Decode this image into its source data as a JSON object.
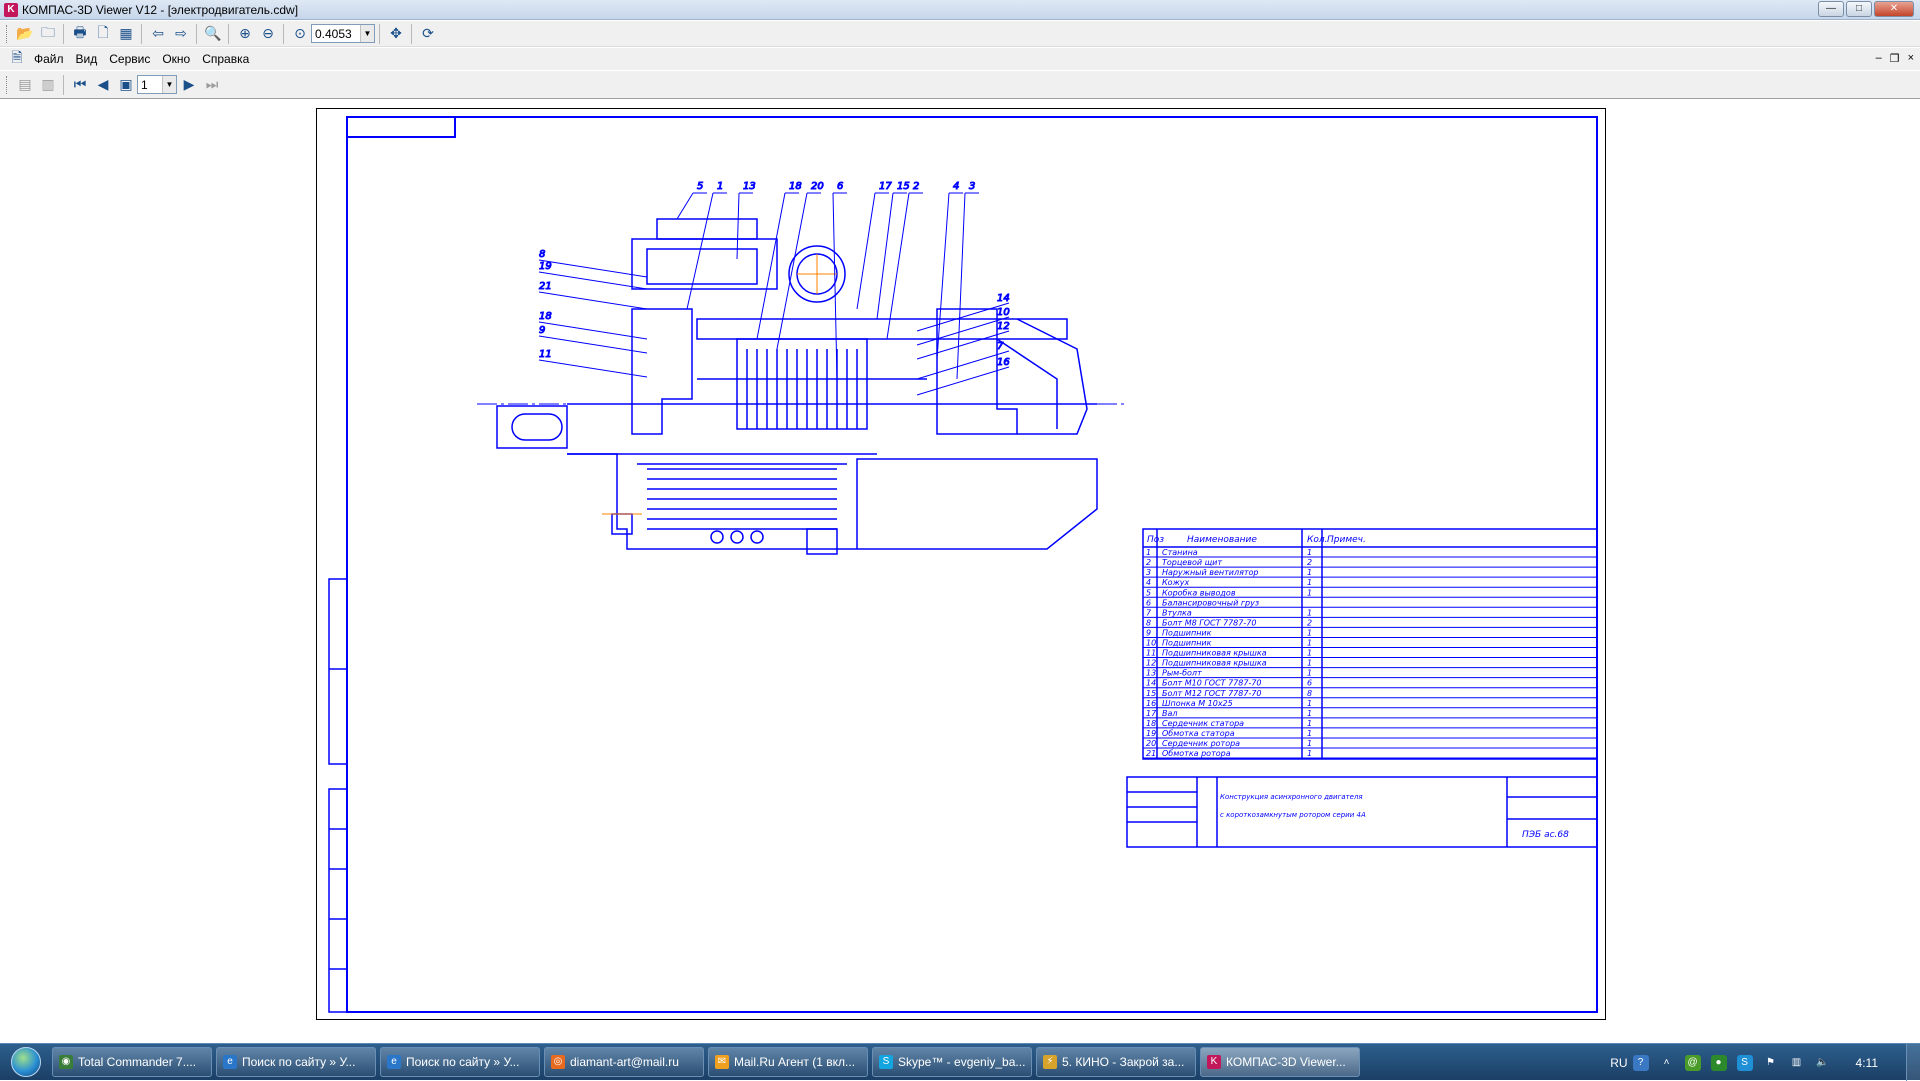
{
  "window": {
    "title": "КОМПАС-3D Viewer V12 - [электродвигатель.cdw]",
    "minimize_glyph": "—",
    "maximize_glyph": "□",
    "close_glyph": "✕"
  },
  "toolbar": {
    "zoom_value": "0.4053"
  },
  "menu": {
    "items": [
      "Файл",
      "Вид",
      "Сервис",
      "Окно",
      "Справка"
    ],
    "mdi_minimize": "–",
    "mdi_restore": "❐",
    "mdi_close": "×"
  },
  "toolbar2": {
    "page_value": "1"
  },
  "drawing": {
    "leader_labels_top": [
      "5",
      "1",
      "13",
      "18",
      "20",
      "6",
      "17",
      "15",
      "2",
      "4",
      "3"
    ],
    "leader_labels_left": [
      "8",
      "19",
      "21",
      "18",
      "9",
      "11"
    ],
    "leader_labels_right": [
      "14",
      "10",
      "12",
      "7",
      "16"
    ],
    "bom_headers": [
      "Поз",
      "Наименование",
      "Кол.",
      "Примеч."
    ],
    "bom": [
      [
        "1",
        "Станина",
        "1"
      ],
      [
        "2",
        "Торцевой щит",
        "2"
      ],
      [
        "3",
        "Наружный вентилятор",
        "1"
      ],
      [
        "4",
        "Кожух",
        "1"
      ],
      [
        "5",
        "Коробка выводов",
        "1"
      ],
      [
        "6",
        "Балансировочный груз",
        ""
      ],
      [
        "7",
        "Втулка",
        "1"
      ],
      [
        "8",
        "Болт М8 ГОСТ 7787-70",
        "2"
      ],
      [
        "9",
        "Подшипник",
        "1"
      ],
      [
        "10",
        "Подшипник",
        "1"
      ],
      [
        "11",
        "Подшипниковая крышка",
        "1"
      ],
      [
        "12",
        "Подшипниковая крышка",
        "1"
      ],
      [
        "13",
        "Рым-болт",
        "1"
      ],
      [
        "14",
        "Болт М10 ГОСТ 7787-70",
        "6"
      ],
      [
        "15",
        "Болт М12 ГОСТ 7787-70",
        "8"
      ],
      [
        "16",
        "Шпонка М 10х25",
        "1"
      ],
      [
        "17",
        "Вал",
        "1"
      ],
      [
        "18",
        "Сердечник статора",
        "1"
      ],
      [
        "19",
        "Обмотка статора",
        "1"
      ],
      [
        "20",
        "Сердечник ротора",
        "1"
      ],
      [
        "21",
        "Обмотка ротора",
        "1"
      ]
    ],
    "title_block_line1": "Конструкция асинхронного двигателя",
    "title_block_line2": "с короткозамкнутым ротором серии 4А",
    "designation": "ПЭБ ас.68"
  },
  "taskbar": {
    "tasks": [
      {
        "label": "Total Commander 7....",
        "icon": "tc-icon"
      },
      {
        "label": "Поиск по сайту » У...",
        "icon": "ie-icon"
      },
      {
        "label": "Поиск по сайту » У...",
        "icon": "ie-icon"
      },
      {
        "label": "diamant-art@mail.ru",
        "icon": "firefox-icon"
      },
      {
        "label": "Mail.Ru Агент (1 вкл...",
        "icon": "mailru-agent-icon"
      },
      {
        "label": "Skype™ - evgeniy_ba...",
        "icon": "skype-icon"
      },
      {
        "label": "5. КИНО - Закрой за...",
        "icon": "winamp-icon"
      },
      {
        "label": "КОМПАС-3D Viewer...",
        "icon": "kompas-icon"
      }
    ],
    "language": "RU",
    "clock": "4:11"
  },
  "colors": {
    "drawing_line": "#0000ff",
    "taskbar": "#1f4670",
    "center_mark": "#ff8000"
  }
}
